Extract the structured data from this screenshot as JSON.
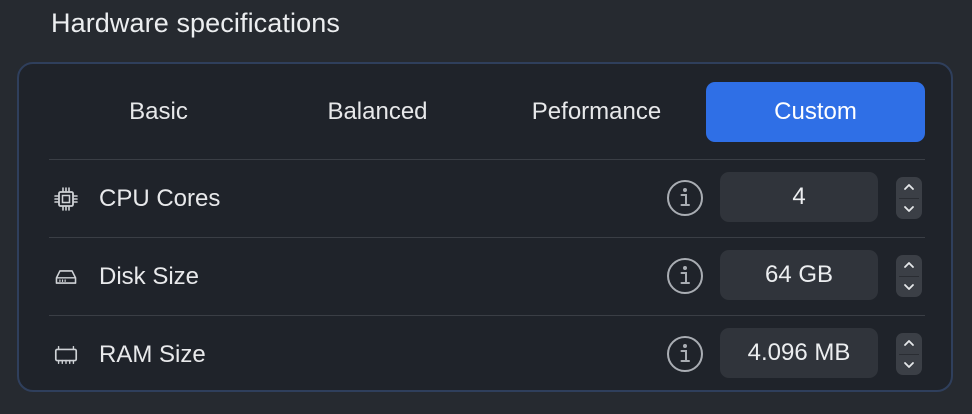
{
  "section": {
    "title": "Hardware specifications"
  },
  "presets": [
    {
      "label": "Basic",
      "active": false
    },
    {
      "label": "Balanced",
      "active": false
    },
    {
      "label": "Peformance",
      "active": false
    },
    {
      "label": "Custom",
      "active": true
    }
  ],
  "rows": [
    {
      "icon": "cpu-icon",
      "label": "CPU Cores",
      "value": "4"
    },
    {
      "icon": "disk-icon",
      "label": "Disk Size",
      "value": "64 GB"
    },
    {
      "icon": "memory-icon",
      "label": "RAM Size",
      "value": "4.096 MB"
    }
  ],
  "colors": {
    "accent": "#2f6fe6",
    "background": "#262a30",
    "panel": "#1f232a",
    "panel_border": "#2f3f5c"
  }
}
